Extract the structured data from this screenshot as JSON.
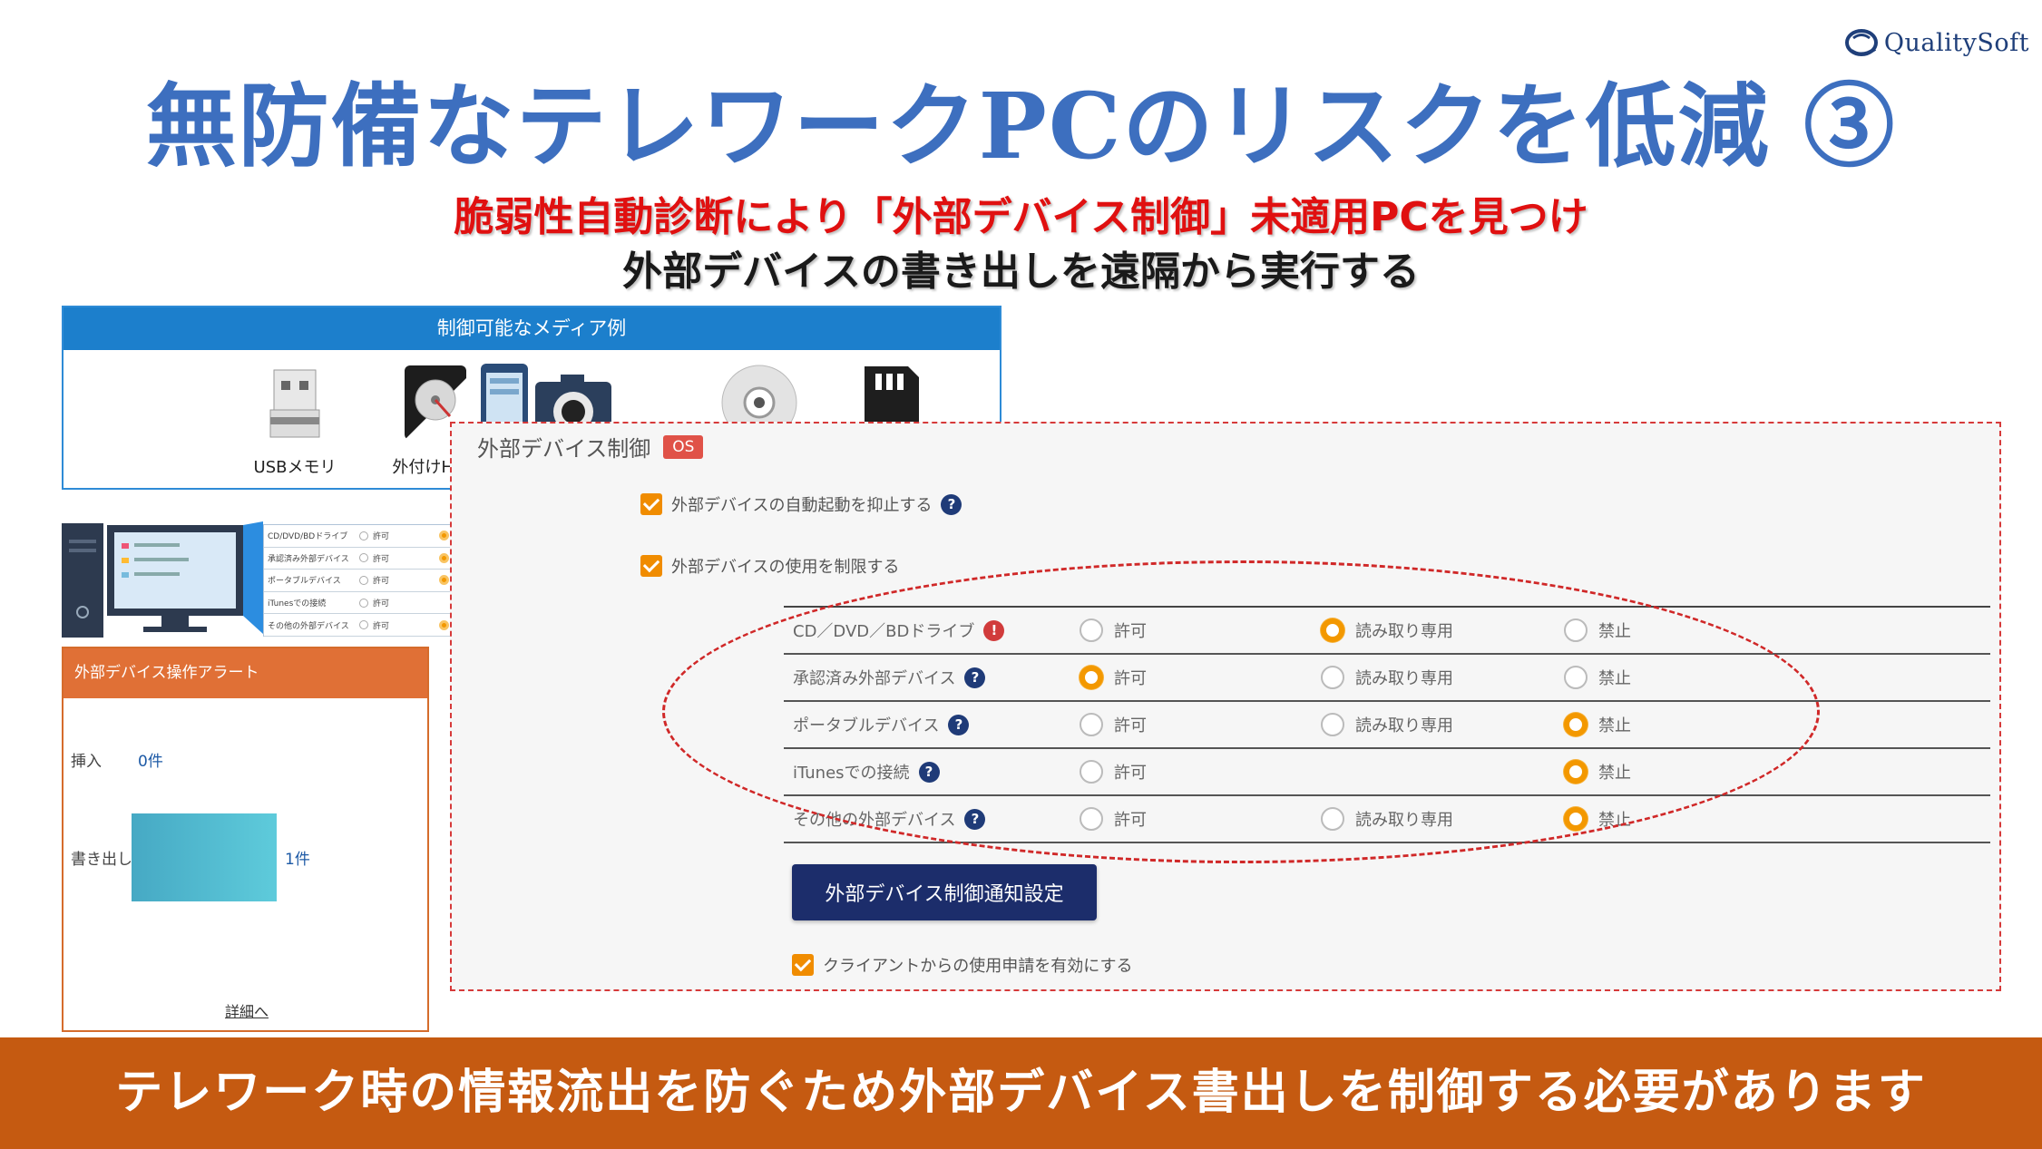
{
  "brand": {
    "name": "QualitySoft"
  },
  "title": "無防備なテレワークPCのリスクを低減 ③",
  "subtitle": {
    "line1": "脆弱性自動診断により「外部デバイス制御」未適用PCを見つけ",
    "line2": "外部デバイスの書き出しを遠隔から実行する"
  },
  "media_panel": {
    "header": "制御可能なメディア例",
    "items": [
      {
        "label": "USBメモリ",
        "icon": "usb-memory-icon"
      },
      {
        "label": "外付けHDD",
        "icon": "external-hdd-icon"
      },
      {
        "label": "",
        "icon": "smartphone-camera-icon"
      },
      {
        "label": "",
        "icon": "cd-disc-icon"
      },
      {
        "label": "",
        "icon": "sd-card-icon"
      }
    ]
  },
  "mini_list": {
    "rows": [
      {
        "name": "CD/DVD/BDドライブ",
        "opt": "許可"
      },
      {
        "name": "承認済み外部デバイス",
        "opt": "許可"
      },
      {
        "name": "ポータブルデバイス",
        "opt": "許可"
      },
      {
        "name": "iTunesでの接続",
        "opt": "許可"
      },
      {
        "name": "その他の外部デバイス",
        "opt": "許可"
      }
    ]
  },
  "alert_panel": {
    "header": "外部デバイス操作アラート",
    "insert_label": "挿入",
    "insert_value": "0件",
    "write_label": "書き出し",
    "write_value": "1件",
    "write_count": 1,
    "details_link": "詳細へ"
  },
  "settings": {
    "section_title": "外部デバイス制御",
    "badge": "OS",
    "suppress_autorun_label": "外部デバイスの自動起動を抑止する",
    "suppress_autorun_checked": true,
    "restrict_usage_label": "外部デバイスの使用を制限する",
    "restrict_usage_checked": true,
    "options": {
      "allow": "許可",
      "readonly": "読み取り専用",
      "deny": "禁止"
    },
    "devices": [
      {
        "name": "CD／DVD／BDドライブ",
        "marker": "warn",
        "selected": "readonly",
        "has_readonly": true
      },
      {
        "name": "承認済み外部デバイス",
        "marker": "help",
        "selected": "allow",
        "has_readonly": true
      },
      {
        "name": "ポータブルデバイス",
        "marker": "help",
        "selected": "deny",
        "has_readonly": true
      },
      {
        "name": "iTunesでの接続",
        "marker": "help",
        "selected": "deny",
        "has_readonly": false
      },
      {
        "name": "その他の外部デバイス",
        "marker": "help",
        "selected": "deny",
        "has_readonly": true
      }
    ],
    "notify_button": "外部デバイス制御通知設定",
    "client_request_label": "クライアントからの使用申請を有効にする",
    "client_request_checked": true
  },
  "banner": "テレワーク時の情報流出を防ぐため外部デバイス書出しを制御する必要があります",
  "colors": {
    "title": "#3d6fbf",
    "subtitle_red": "#e01010",
    "accent_orange": "#f39800",
    "banner": "#c55a11",
    "button_navy": "#1c2d6b"
  }
}
